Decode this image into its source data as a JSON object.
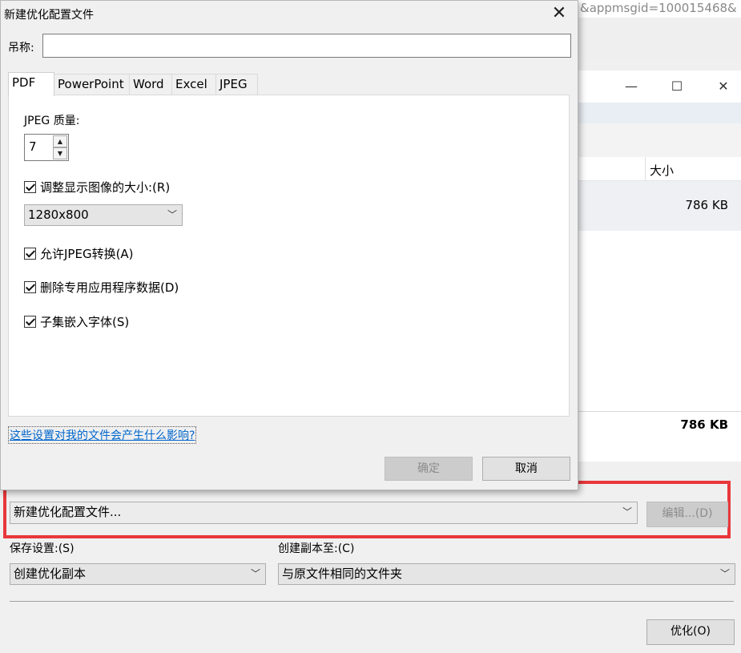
{
  "background": {
    "url_fragment": "&appmsgid=100015468&",
    "window_controls": {
      "minimize": "—",
      "maximize": "☐",
      "close": "✕"
    },
    "size_column_header": "大小",
    "file_size": "786 KB",
    "total_size": "786 KB"
  },
  "dialog": {
    "title": "新建优化配置文件",
    "close_glyph": "✕",
    "name_label": "吊称:",
    "name_value": "",
    "tabs": [
      {
        "label": "PDF"
      },
      {
        "label": "PowerPoint"
      },
      {
        "label": "Word"
      },
      {
        "label": "Excel"
      },
      {
        "label": "JPEG"
      }
    ],
    "active_tab": "PDF",
    "jpeg_quality_label": "JPEG 质量:",
    "jpeg_quality_value": "7",
    "resize_images_label": "调整显示图像的大小:(R)",
    "resize_images_checked": true,
    "resolution_value": "1280x800",
    "allow_jpeg_label": "允许JPEG转换(A)",
    "allow_jpeg_checked": true,
    "remove_app_data_label": "删除专用应用程序数据(D)",
    "remove_app_data_checked": true,
    "subset_fonts_label": "子集嵌入字体(S)",
    "subset_fonts_checked": true,
    "help_link": "这些设置对我的文件会产生什么影响?",
    "ok_label": "确定",
    "cancel_label": "取消"
  },
  "main": {
    "profile_value": "新建优化配置文件...",
    "edit_label": "编辑...(D)",
    "save_settings_label": "保存设置:(S)",
    "save_settings_value": "创建优化副本",
    "copy_to_label": "创建副本至:(C)",
    "copy_to_value": "与原文件相同的文件夹",
    "optimize_label": "优化(O)",
    "highlight_color": "#e8373b"
  }
}
